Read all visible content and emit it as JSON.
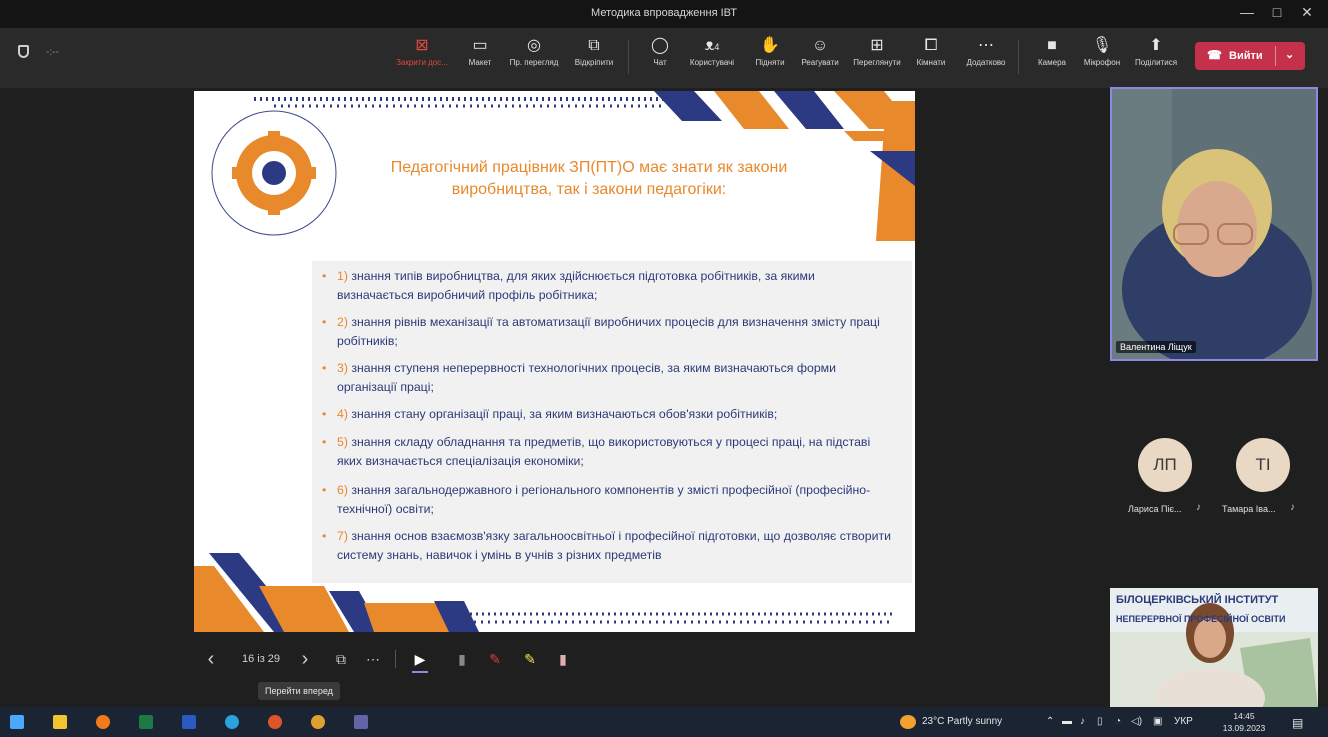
{
  "window": {
    "title": "Методика впровадження ІВТ",
    "minimize": "—",
    "maximize": "□",
    "close": "✕"
  },
  "toolbar": {
    "timer": "-:--",
    "buttons": [
      {
        "label": "Закрити дос...",
        "icon": "close-share-icon",
        "glyph": "⊠"
      },
      {
        "label": "Макет",
        "icon": "layout-icon",
        "glyph": "▭"
      },
      {
        "label": "Пр. перегляд",
        "icon": "preview-icon",
        "glyph": "◎"
      },
      {
        "label": "Відкріпити",
        "icon": "unpin-icon",
        "glyph": "⧉"
      },
      {
        "label": "Чат",
        "icon": "chat-icon",
        "glyph": "◯"
      },
      {
        "label": "Користувачі",
        "icon": "people-icon",
        "glyph": "ᴥ"
      },
      {
        "label": "Підняти",
        "icon": "raise-hand-icon",
        "glyph": "✋"
      },
      {
        "label": "Реагувати",
        "icon": "react-icon",
        "glyph": "☺"
      },
      {
        "label": "Переглянути",
        "icon": "view-icon",
        "glyph": "⊞"
      },
      {
        "label": "Кімнати",
        "icon": "rooms-icon",
        "glyph": "⧠"
      },
      {
        "label": "Додатково",
        "icon": "more-icon",
        "glyph": "⋯"
      },
      {
        "label": "Камера",
        "icon": "camera-icon",
        "glyph": "■"
      },
      {
        "label": "Мікрофон",
        "icon": "microphone-icon",
        "glyph": "🎙"
      },
      {
        "label": "Поділитися",
        "icon": "share-icon",
        "glyph": "⬆"
      }
    ],
    "people_count": "4",
    "leave": "Вийти"
  },
  "slide": {
    "title": "Педагогічний працівник ЗП(ПТ)О має знати як закони виробництва, так і закони педагогіки:",
    "bullets": [
      {
        "num": "1)",
        "text": "знання типів виробництва, для яких здійснюється підготовка робітників, за якими визначається виробничий профіль робітника;"
      },
      {
        "num": "2)",
        "text": "знання рівнів механізації та автоматизації виробничих процесів для визначення змісту праці робітників;"
      },
      {
        "num": "3)",
        "text": "знання ступеня неперервності технологічних процесів, за яким визначаються форми організації праці;"
      },
      {
        "num": "4)",
        "text": "знання стану організації праці, за яким визначаються обов'язки робітників;"
      },
      {
        "num": "5)",
        "text": "знання складу обладнання та предметів, що використовуються у процесі праці, на підставі яких визначається спеціалізація економіки;"
      },
      {
        "num": "6)",
        "text": "знання загальнодержавного і регіонального компонентів у змісті професійної (професійно-технічної) освіти;"
      },
      {
        "num": "7)",
        "text": "знання основ взаємозв'язку загальноосвітньої і професійної підготовки, що дозволяє створити систему знань, навичок і умінь в учнів з різних предметів"
      }
    ]
  },
  "participants": {
    "main_name": "Валентина Ліщук",
    "others": [
      {
        "initials": "ЛП",
        "name": "Лариса Піє..."
      },
      {
        "initials": "ТІ",
        "name": "Тамара Іва..."
      }
    ],
    "institute_line1": "БІЛОЦЕРКІВСЬКИЙ ІНСТИТУТ",
    "institute_line2": "НЕПЕРЕРВНОЇ ПРОФЕСІЙНОЇ ОСВІТИ"
  },
  "slide_controls": {
    "prev": "‹",
    "page": "16 із 29",
    "next": "›",
    "tooltip": "Перейти вперед"
  },
  "taskbar": {
    "weather": "23°C  Partly sunny",
    "lang": "УКР",
    "time": "14:45",
    "date": "13.09.2023"
  },
  "colors": {
    "accent_orange": "#e8892c",
    "accent_navy": "#2c3a78",
    "leave_red": "#c4314b"
  }
}
